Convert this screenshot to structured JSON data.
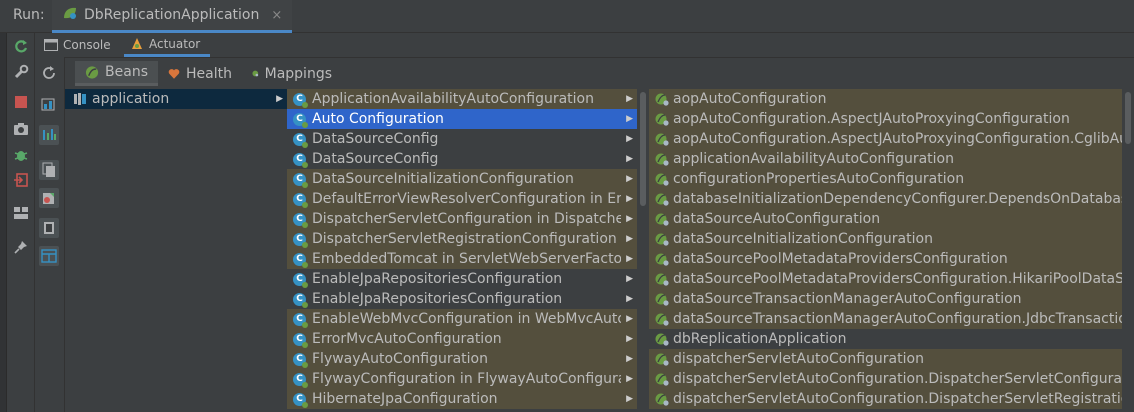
{
  "titlebar": {
    "run_label": "Run:",
    "tab_title": "DbReplicationApplication",
    "close_glyph": "×"
  },
  "tabs": {
    "console": "Console",
    "actuator": "Actuator"
  },
  "bean_tabs": {
    "beans": "Beans",
    "health": "Health",
    "mappings": "Mappings"
  },
  "col1": {
    "items": [
      {
        "label": "application"
      }
    ]
  },
  "col2": {
    "items": [
      {
        "label": "ApplicationAvailabilityAutoConfiguration",
        "state": "hl"
      },
      {
        "label": "Auto Configuration",
        "state": "sel"
      },
      {
        "label": "DataSourceConfig",
        "state": ""
      },
      {
        "label": "DataSourceConfig",
        "state": ""
      },
      {
        "label": "DataSourceInitializationConfiguration",
        "state": "hl"
      },
      {
        "label": "DefaultErrorViewResolverConfiguration in ErrorMvcAutoConfiguration",
        "state": "hl"
      },
      {
        "label": "DispatcherServletConfiguration in DispatcherServletAutoConfiguration",
        "state": "hl"
      },
      {
        "label": "DispatcherServletRegistrationConfiguration in DispatcherServletAutoConfiguration",
        "state": "hl"
      },
      {
        "label": "EmbeddedTomcat in ServletWebServerFactoryConfiguration",
        "state": "hl"
      },
      {
        "label": "EnableJpaRepositoriesConfiguration",
        "state": ""
      },
      {
        "label": "EnableJpaRepositoriesConfiguration",
        "state": ""
      },
      {
        "label": "EnableWebMvcConfiguration in WebMvcAutoConfiguration",
        "state": "hl"
      },
      {
        "label": "ErrorMvcAutoConfiguration",
        "state": "hl"
      },
      {
        "label": "FlywayAutoConfiguration",
        "state": "hl"
      },
      {
        "label": "FlywayConfiguration in FlywayAutoConfiguration",
        "state": "hl"
      },
      {
        "label": "HibernateJpaConfiguration",
        "state": "hl"
      }
    ]
  },
  "col3": {
    "items": [
      {
        "label": "aopAutoConfiguration",
        "state": "hl"
      },
      {
        "label": "aopAutoConfiguration.AspectJAutoProxyingConfiguration",
        "state": "hl"
      },
      {
        "label": "aopAutoConfiguration.AspectJAutoProxyingConfiguration.CglibAutoProxyConfiguration",
        "state": "hl"
      },
      {
        "label": "applicationAvailabilityAutoConfiguration",
        "state": "hl"
      },
      {
        "label": "configurationPropertiesAutoConfiguration",
        "state": "hl"
      },
      {
        "label": "databaseInitializationDependencyConfigurer.DependsOnDatabaseInitializationPostProcessor",
        "state": "hl"
      },
      {
        "label": "dataSourceAutoConfiguration",
        "state": "hl"
      },
      {
        "label": "dataSourceInitializationConfiguration",
        "state": "hl"
      },
      {
        "label": "dataSourcePoolMetadataProvidersConfiguration",
        "state": "hl"
      },
      {
        "label": "dataSourcePoolMetadataProvidersConfiguration.HikariPoolDataSourceMetadataProviderConfiguration",
        "state": "hl"
      },
      {
        "label": "dataSourceTransactionManagerAutoConfiguration",
        "state": "hl"
      },
      {
        "label": "dataSourceTransactionManagerAutoConfiguration.JdbcTransactionManagerConfiguration",
        "state": "hl"
      },
      {
        "label": "dbReplicationApplication",
        "state": ""
      },
      {
        "label": "dispatcherServletAutoConfiguration",
        "state": "hl"
      },
      {
        "label": "dispatcherServletAutoConfiguration.DispatcherServletConfiguration",
        "state": "hl"
      },
      {
        "label": "dispatcherServletAutoConfiguration.DispatcherServletRegistrationConfiguration",
        "state": "hl"
      }
    ]
  },
  "colors": {
    "selection": "#2f65ca",
    "autoconfig_highlight": "#544f3d",
    "context_row": "#0d293e",
    "accent_tab": "#4a88c7",
    "spring_green": "#6a9b43"
  },
  "icons": {
    "rerun": "rerun-icon",
    "wrench": "wrench-icon",
    "stop": "stop-icon",
    "camera": "camera-icon",
    "bug": "bug-icon",
    "exit": "exit-icon",
    "layout": "layout-icon",
    "pin": "pin-icon",
    "refresh": "refresh-icon"
  }
}
